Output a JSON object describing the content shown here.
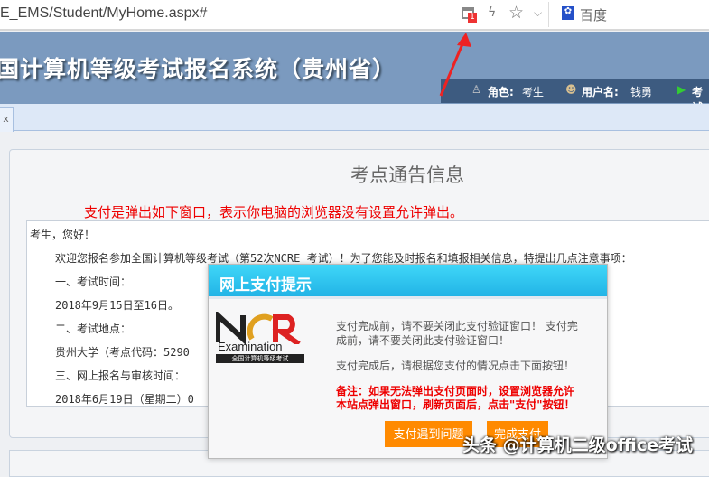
{
  "browser": {
    "url": "E_EMS/Student/MyHome.aspx#",
    "popup_badge": "1",
    "search_engine": "百度"
  },
  "header": {
    "title": "国计算机等级考试报名系统（贵州省）",
    "role_label": "角色:",
    "role_value": "考生",
    "user_label": "用户名:",
    "user_value": "钱勇",
    "exam_label": "考试"
  },
  "tabs": {
    "close": "x"
  },
  "notice": {
    "title": "考点通告信息",
    "annotation": "支付是弹出如下窗口，表示你电脑的浏览器没有设置允许弹出。",
    "lines": [
      "考生，您好！",
      "欢迎您报名参加全国计算机等级考试（第52次NCRE 考试）！为了您能及时报名和填报相关信息，特提出几点注意事项：",
      "一、考试时间：",
      "2018年9月15日至16日。",
      "二、考试地点：",
      "贵州大学（考点代码：5290",
      "三、网上报名与审核时间：",
      "2018年6月19日（星期二）0"
    ]
  },
  "dialog": {
    "title": "网上支付提示",
    "logo_text": "Examination",
    "logo_sub": "全国计算机等级考试",
    "msg1a": "支付完成前，请不要关闭此支付验证窗口！ 支付完",
    "msg1b": "成前，请不要关闭此支付验证窗口！",
    "msg2": "支付完成后，请根据您支付的情况点击下面按钮！",
    "note1": "备注：如果无法弹出支付页面时，设置浏览器允许",
    "note2": "本站点弹出窗口，刷新页面后，点击\"支付\"按钮！",
    "btn_problem": "支付遇到问题",
    "btn_done": "完成支付"
  },
  "watermark": "头条 @计算机二级office考试",
  "colors": {
    "header": "#7b9abf",
    "button": "#ff8a00",
    "dialog_header": "#22b4e6",
    "annotation": "#ee0000"
  }
}
